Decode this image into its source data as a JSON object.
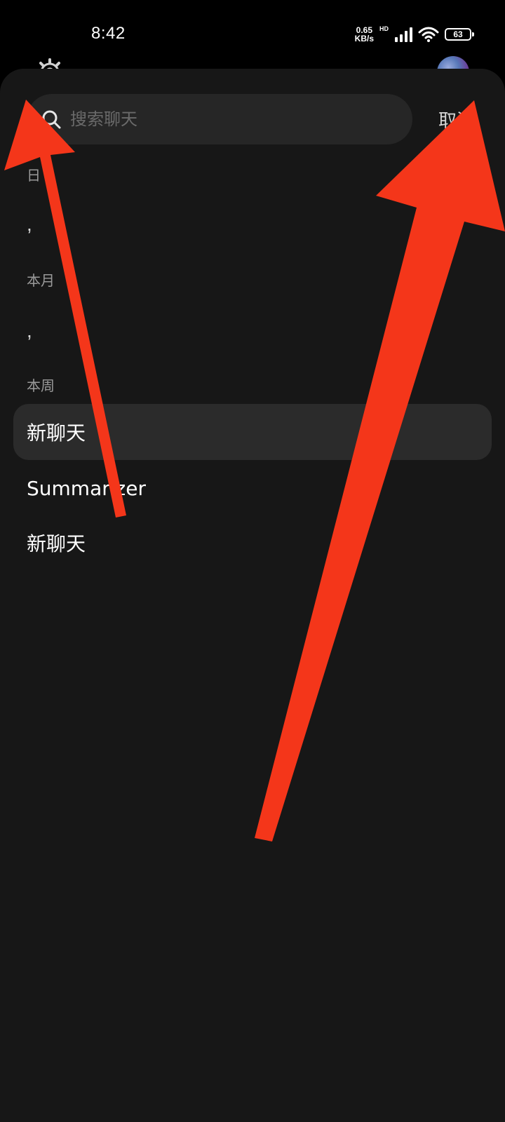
{
  "status_bar": {
    "time": "8:42",
    "speed_value": "0.65",
    "speed_unit": "KB/s",
    "network_type": "HD",
    "battery": "63"
  },
  "background_header": {
    "title": "           "
  },
  "search": {
    "placeholder": "搜索聊天",
    "value": "",
    "cancel_label": "取消"
  },
  "sections": [
    {
      "label": "日",
      "items": [
        ",",
        ""
      ]
    },
    {
      "label": "本月",
      "items": [
        ","
      ]
    },
    {
      "label": "本周",
      "items": [
        "新聊天",
        "Summarizer",
        "新聊天"
      ]
    }
  ],
  "colors": {
    "accent": "#f4361a",
    "sheet_bg": "#171717",
    "selected_bg": "#2b2b2b"
  },
  "icons": [
    "search-icon",
    "gear-icon",
    "wifi-icon",
    "signal-icon",
    "battery-icon"
  ]
}
